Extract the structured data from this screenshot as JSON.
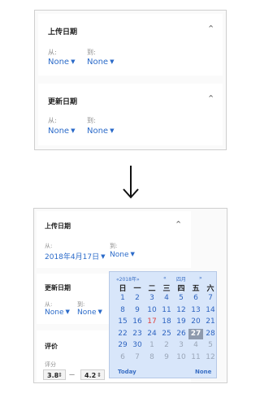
{
  "before": {
    "filters": [
      {
        "title": "上传日期",
        "from_label": "从:",
        "to_label": "到:",
        "from_value": "None",
        "to_value": "None"
      },
      {
        "title": "更新日期",
        "from_label": "从:",
        "to_label": "到:",
        "from_value": "None",
        "to_value": "None"
      }
    ]
  },
  "transition_arrow": "↓",
  "after": {
    "upload": {
      "title": "上传日期",
      "from_label": "从:",
      "to_label": "到:",
      "from_value": "2018年4月17日",
      "to_value": "None"
    },
    "update": {
      "title": "更新日期",
      "from_label": "从:",
      "to_label": "到:",
      "from_value": "None",
      "to_value": "None"
    },
    "rating": {
      "title": "评价",
      "label": "评分",
      "min_value": "3.8",
      "separator": "—",
      "max_value": "4.2"
    },
    "calendar": {
      "prev_year": "«2018年»",
      "prev_month": "«",
      "month": "四月",
      "next_month": "»",
      "weekdays": [
        "日",
        "一",
        "二",
        "三",
        "四",
        "五",
        "六"
      ],
      "weeks": [
        [
          "1",
          "2",
          "3",
          "4",
          "5",
          "6",
          "7"
        ],
        [
          "8",
          "9",
          "10",
          "11",
          "12",
          "13",
          "14"
        ],
        [
          "15",
          "16",
          "17",
          "18",
          "19",
          "20",
          "21"
        ],
        [
          "22",
          "23",
          "24",
          "25",
          "26",
          "27",
          "28"
        ],
        [
          "29",
          "30",
          "1",
          "2",
          "3",
          "4",
          "5"
        ],
        [
          "6",
          "7",
          "8",
          "9",
          "10",
          "11",
          "12"
        ]
      ],
      "today_label": "Today",
      "none_label": "None"
    }
  }
}
